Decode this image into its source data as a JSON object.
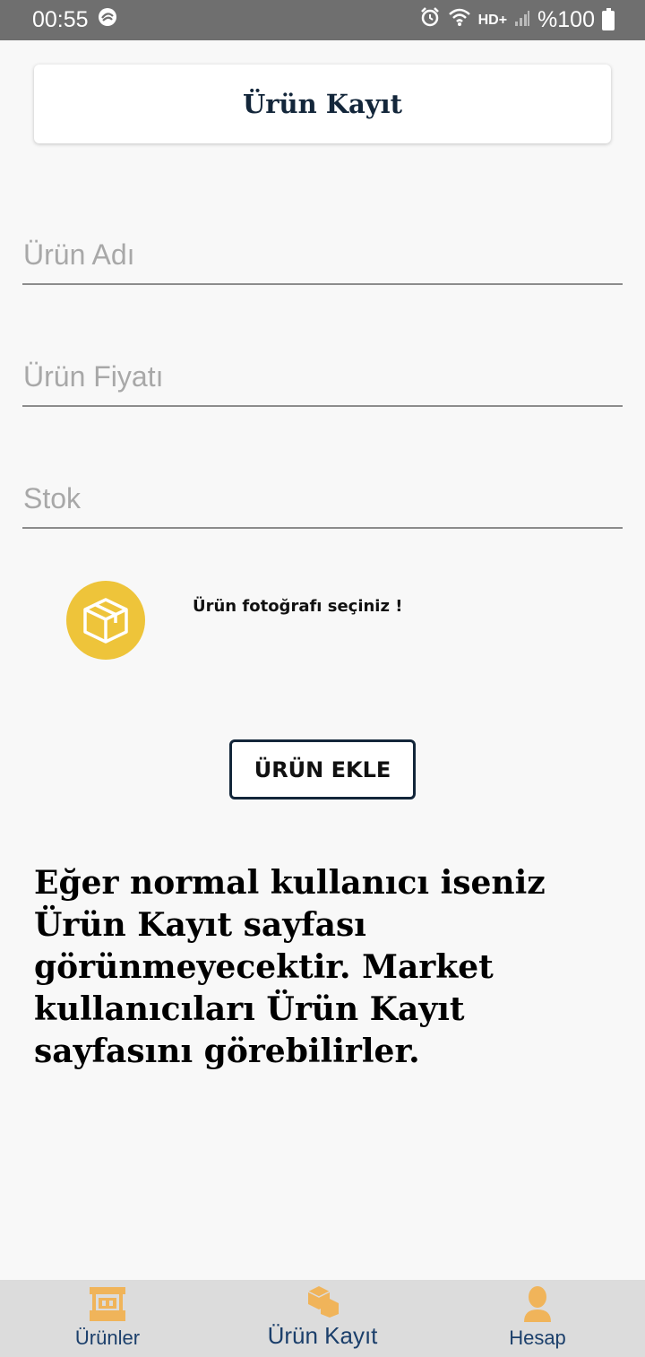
{
  "status_bar": {
    "time": "00:55",
    "network": "HD+",
    "battery": "%100"
  },
  "header": {
    "title": "Ürün Kayıt"
  },
  "form": {
    "name_placeholder": "Ürün Adı",
    "price_placeholder": "Ürün Fiyatı",
    "stock_placeholder": "Stok",
    "photo_label": "Ürün fotoğrafı seçiniz !",
    "submit_label": "ÜRÜN EKLE"
  },
  "info": {
    "text": "Eğer normal kullanıcı iseniz Ürün Kayıt sayfası görünmeyecektir. Market kullanıcıları Ürün Kayıt sayfasını görebilirler."
  },
  "bottom_nav": {
    "items": [
      {
        "label": "Ürünler",
        "icon": "store-icon"
      },
      {
        "label": "Ürün Kayıt",
        "icon": "boxes-icon",
        "active": true
      },
      {
        "label": "Hesap",
        "icon": "user-icon"
      }
    ]
  },
  "colors": {
    "accent": "#eec43a",
    "icon_orange": "#f0b45a",
    "navy": "#13263a",
    "nav_text": "#1b3f6b"
  }
}
